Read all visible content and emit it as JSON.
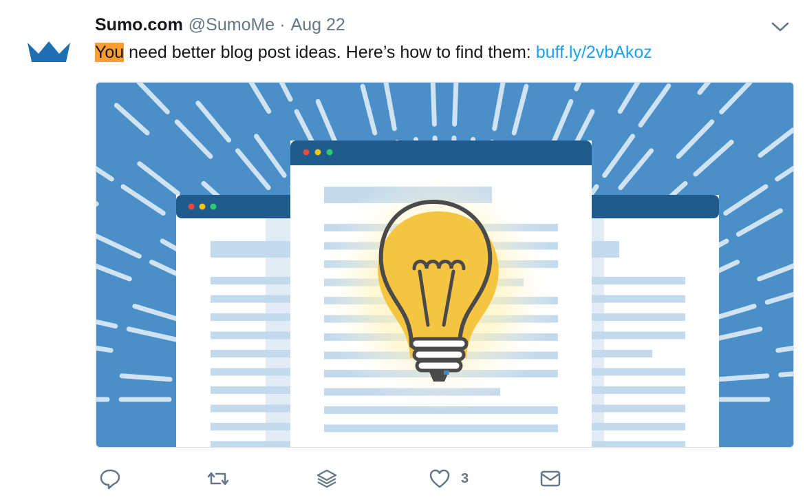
{
  "tweet": {
    "author_name": "Sumo.com",
    "author_handle": "@SumoMe",
    "separator": "·",
    "date": "Aug 22",
    "text_highlight": "You",
    "text_body": " need better blog post ideas. Here’s how to find them: ",
    "link_text": "buff.ly/2vbAkoz"
  },
  "actions": {
    "like_count": "3"
  },
  "icons": {
    "avatar": "crown-logo-icon",
    "menu": "chevron-down-icon",
    "reply": "reply-icon",
    "retweet": "retweet-icon",
    "layers": "layers-icon",
    "like": "heart-icon",
    "dm": "envelope-icon"
  },
  "colors": {
    "highlight": "#ff9d35",
    "link": "#1da1f2",
    "avatar": "#1f6fb2",
    "media_bg": "#4a8fc7",
    "bulb": "#f5c542"
  }
}
